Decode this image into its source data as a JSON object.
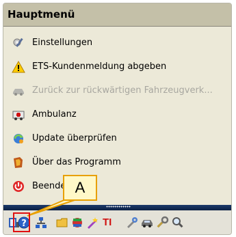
{
  "menu": {
    "title": "Hauptmenü",
    "items": [
      {
        "label": "Einstellungen",
        "icon": "settings-icon",
        "disabled": false
      },
      {
        "label": "ETS-Kundenmeldung abgeben",
        "icon": "warning-icon",
        "disabled": false
      },
      {
        "label": "Zurück zur rückwärtigen Fahrzeugverk...",
        "icon": "car-back-icon",
        "disabled": true
      },
      {
        "label": "Ambulanz",
        "icon": "ambulance-icon",
        "disabled": false
      },
      {
        "label": "Update überprüfen",
        "icon": "update-icon",
        "disabled": false
      },
      {
        "label": "Über das Programm",
        "icon": "info-icon",
        "disabled": false
      },
      {
        "label": "Beenden",
        "icon": "power-icon",
        "disabled": false
      }
    ]
  },
  "toolbar": {
    "icons": [
      "book-icon",
      "help-icon",
      "network-icon",
      "folder-icon",
      "multimedia-icon",
      "wand-icon",
      "ti-icon",
      "tool-icon",
      "car-icon",
      "wrench-icon",
      "magnifier-icon"
    ],
    "ti_label": "TI"
  },
  "callout": {
    "label": "A"
  },
  "colors": {
    "header": "#c4c0a8",
    "panel": "#ece9d8",
    "separator": "#0a1f44",
    "highlight": "#e01010",
    "callout_border": "#e8a000"
  }
}
